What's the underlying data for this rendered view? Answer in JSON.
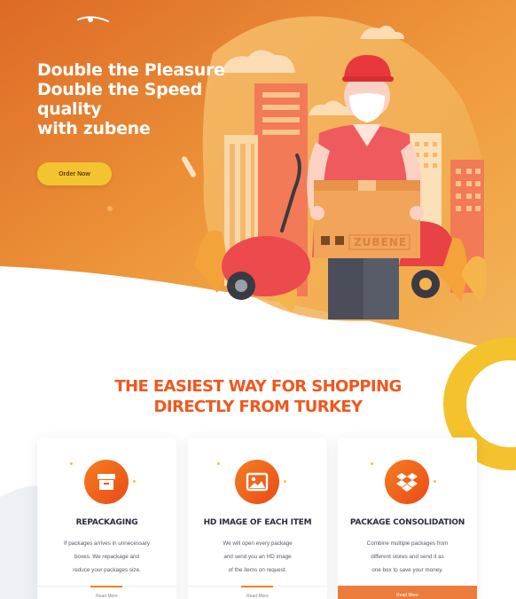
{
  "hero": {
    "title_lines": [
      "Double the Pleasure",
      "Double the Speed",
      "quality",
      "with zubene"
    ],
    "order_button": "Order Now",
    "box_brand": "ZUBENE"
  },
  "section": {
    "title_line1": "THE EASIEST WAY FOR SHOPPING",
    "title_line2": "DIRECTLY FROM TURKEY"
  },
  "services": [
    {
      "title": "REPACKAGING",
      "icon": "box-icon",
      "lines": [
        "If packages arrives in unnecessary",
        "boxes. We repackage and",
        "reduce your packages size."
      ],
      "link": "Read More"
    },
    {
      "title": "HD IMAGE OF EACH ITEM",
      "icon": "image-icon",
      "lines": [
        "We will open every package",
        "and send you an HD image",
        "of the items on request."
      ],
      "link": "Read More"
    },
    {
      "title": "PACKAGE CONSOLIDATION",
      "icon": "dropbox-icon",
      "lines": [
        "Combine multiple packages from",
        "different stores and send it as",
        "one box to save your money."
      ],
      "link": "Read More"
    }
  ],
  "colors": {
    "hero_orange": "#e8722a",
    "accent_yellow": "#f4c430",
    "title_orange": "#f0571e",
    "dark_text": "#2a2d3a"
  }
}
